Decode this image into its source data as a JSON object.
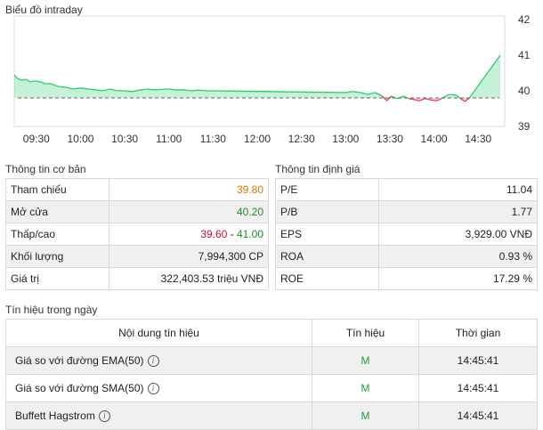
{
  "chart": {
    "title": "Biểu đồ intraday",
    "colors": {
      "up": "#2ecc71",
      "down": "#e0455a",
      "reference": "#666666"
    },
    "reference_line": "dashed"
  },
  "chart_data": {
    "type": "area",
    "x_ticks": [
      "09:30",
      "10:00",
      "10:30",
      "11:00",
      "11:30",
      "12:00",
      "12:30",
      "13:00",
      "13:30",
      "14:00",
      "14:30"
    ],
    "y_ticks": [
      39,
      40,
      41,
      42
    ],
    "ylim": [
      39,
      42.1
    ],
    "reference": 39.8,
    "series": [
      {
        "points": [
          [
            "09:15",
            40.45
          ],
          [
            "09:17",
            40.35
          ],
          [
            "09:20",
            40.3
          ],
          [
            "09:23",
            40.32
          ],
          [
            "09:26",
            40.25
          ],
          [
            "09:29",
            40.28
          ],
          [
            "09:33",
            40.25
          ],
          [
            "09:36",
            40.2
          ],
          [
            "09:40",
            40.2
          ],
          [
            "09:45",
            40.12
          ],
          [
            "09:50",
            40.1
          ],
          [
            "09:55",
            40.05
          ],
          [
            "10:00",
            40.08
          ],
          [
            "10:05",
            40.05
          ],
          [
            "10:10",
            40.03
          ],
          [
            "10:15",
            40.0
          ],
          [
            "10:20",
            40.05
          ],
          [
            "10:25",
            40.0
          ],
          [
            "10:30",
            40.0
          ],
          [
            "10:35",
            39.98
          ],
          [
            "10:40",
            40.02
          ],
          [
            "10:45",
            40.05
          ],
          [
            "10:50",
            40.03
          ],
          [
            "10:55",
            40.04
          ],
          [
            "11:00",
            40.05
          ],
          [
            "11:05",
            40.02
          ],
          [
            "11:10",
            40.03
          ],
          [
            "11:15",
            40.0
          ],
          [
            "11:20",
            40.02
          ],
          [
            "11:25",
            40.0
          ],
          [
            "11:30",
            40.0
          ],
          [
            "13:00",
            39.95
          ],
          [
            "13:05",
            39.98
          ],
          [
            "13:10",
            39.95
          ],
          [
            "13:15",
            39.9
          ],
          [
            "13:20",
            39.95
          ],
          [
            "13:25",
            39.85
          ],
          [
            "13:28",
            39.72
          ],
          [
            "13:31",
            39.85
          ],
          [
            "13:35",
            39.78
          ],
          [
            "13:39",
            39.85
          ],
          [
            "13:43",
            39.78
          ],
          [
            "13:47",
            39.75
          ],
          [
            "13:50",
            39.72
          ],
          [
            "13:54",
            39.78
          ],
          [
            "13:58",
            39.74
          ],
          [
            "14:02",
            39.72
          ],
          [
            "14:05",
            39.78
          ],
          [
            "14:10",
            39.9
          ],
          [
            "14:15",
            39.88
          ],
          [
            "14:18",
            39.78
          ],
          [
            "14:21",
            39.7
          ],
          [
            "14:24",
            39.8
          ],
          [
            "14:45",
            41.0
          ]
        ]
      }
    ]
  },
  "basic_info": {
    "title": "Thông tin cơ bản",
    "rows": [
      {
        "label": "Tham chiếu",
        "value": "39.80",
        "color": "#d97c00"
      },
      {
        "label": "Mở cửa",
        "value": "40.20",
        "color": "#1a8c2a"
      },
      {
        "label": "Thấp/cao",
        "value_low": "39.60",
        "sep": " - ",
        "value_high": "41.00",
        "colors": [
          "#c8102e",
          "#1a8c2a"
        ]
      },
      {
        "label": "Khối lượng",
        "value": "7,994,300 CP"
      },
      {
        "label": "Giá trị",
        "value": "322,403.53 triệu VNĐ"
      }
    ]
  },
  "valuation": {
    "title": "Thông tin định giá",
    "rows": [
      {
        "label": "P/E",
        "value": "11.04"
      },
      {
        "label": "P/B",
        "value": "1.77"
      },
      {
        "label": "EPS",
        "value": "3,929.00 VNĐ"
      },
      {
        "label": "ROA",
        "value": "0.93 %"
      },
      {
        "label": "ROE",
        "value": "17.29 %"
      }
    ]
  },
  "signals": {
    "title": "Tín hiệu trong ngày",
    "headers": [
      "Nội dung tín hiệu",
      "Tín hiệu",
      "Thời gian"
    ],
    "rows": [
      {
        "name": "Giá so với đường EMA(50)",
        "signal": "M",
        "time": "14:45:41"
      },
      {
        "name": "Giá so với đường SMA(50)",
        "signal": "M",
        "time": "14:45:41"
      },
      {
        "name": "Buffett Hagstrom",
        "signal": "M",
        "time": "14:45:41"
      }
    ]
  }
}
